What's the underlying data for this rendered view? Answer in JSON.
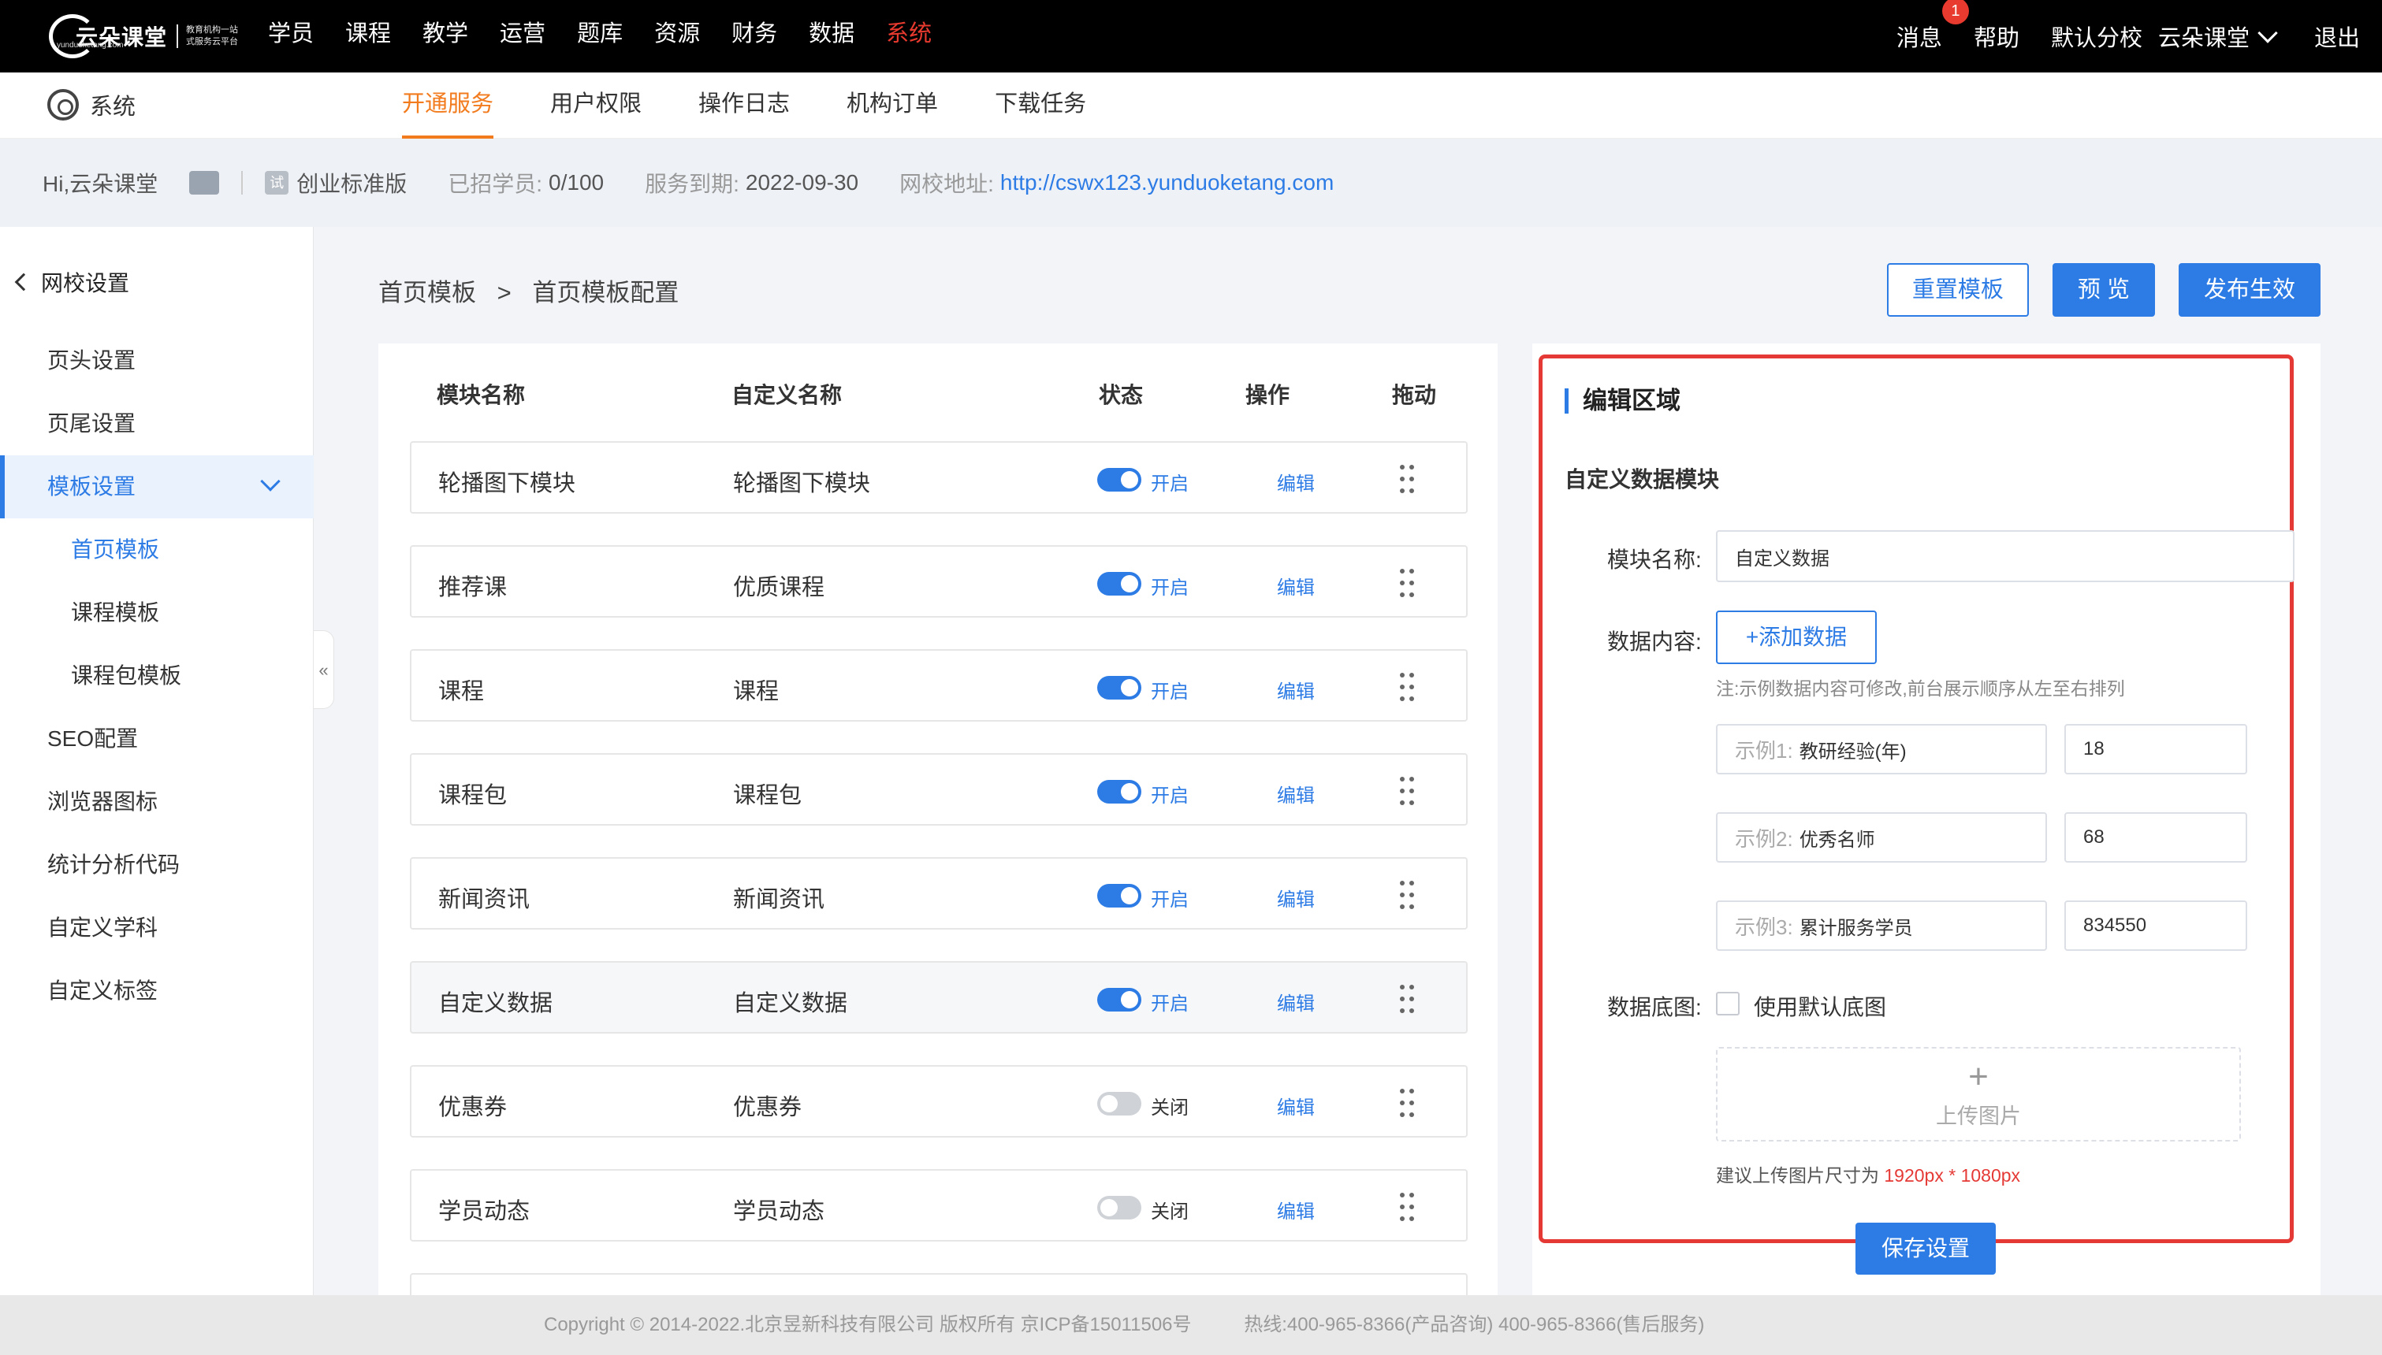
{
  "topbar": {
    "logo_text": "云朵课堂",
    "logo_sub1": "教育机构一站",
    "logo_sub2": "式服务云平台",
    "logo_url": "yunduoketang.com",
    "nav": [
      "学员",
      "课程",
      "教学",
      "运营",
      "题库",
      "资源",
      "财务",
      "数据",
      "系统"
    ],
    "active_nav": "系统",
    "messages_label": "消息",
    "messages_badge": "1",
    "help_label": "帮助",
    "branch_label": "默认分校",
    "account_label": "云朵课堂",
    "logout_label": "退出"
  },
  "subbar": {
    "section_label": "系统",
    "tabs": [
      "开通服务",
      "用户权限",
      "操作日志",
      "机构订单",
      "下载任务"
    ],
    "active_tab": "开通服务"
  },
  "infobar": {
    "greeting": "Hi,云朵课堂",
    "trial_badge": "试",
    "edition": "创业标准版",
    "students_label": "已招学员:",
    "students_value": "0/100",
    "expiry_label": "服务到期:",
    "expiry_value": "2022-09-30",
    "url_label": "网校地址:",
    "url_value": "http://cswx123.yunduoketang.com"
  },
  "sidebar": {
    "header": "网校设置",
    "items": [
      {
        "label": "页头设置",
        "level": 1
      },
      {
        "label": "页尾设置",
        "level": 1
      },
      {
        "label": "模板设置",
        "level": 1,
        "active": true
      },
      {
        "label": "首页模板",
        "level": 2,
        "active": true
      },
      {
        "label": "课程模板",
        "level": 2
      },
      {
        "label": "课程包模板",
        "level": 2
      },
      {
        "label": "SEO配置",
        "level": 1
      },
      {
        "label": "浏览器图标",
        "level": 1
      },
      {
        "label": "统计分析代码",
        "level": 1
      },
      {
        "label": "自定义学科",
        "level": 1
      },
      {
        "label": "自定义标签",
        "level": 1
      }
    ],
    "collapse_icon": "«"
  },
  "breadcrumb": {
    "parent": "首页模板",
    "separator": ">",
    "current": "首页模板配置"
  },
  "actions": {
    "reset": "重置模板",
    "preview": "预 览",
    "publish": "发布生效"
  },
  "table": {
    "headers": {
      "name": "模块名称",
      "custom": "自定义名称",
      "status": "状态",
      "op": "操作",
      "drag": "拖动"
    },
    "rows": [
      {
        "name": "轮播图下模块",
        "custom": "轮播图下模块",
        "on": true,
        "status": "开启",
        "op": "编辑"
      },
      {
        "name": "推荐课",
        "custom": "优质课程",
        "on": true,
        "status": "开启",
        "op": "编辑"
      },
      {
        "name": "课程",
        "custom": "课程",
        "on": true,
        "status": "开启",
        "op": "编辑"
      },
      {
        "name": "课程包",
        "custom": "课程包",
        "on": true,
        "status": "开启",
        "op": "编辑"
      },
      {
        "name": "新闻资讯",
        "custom": "新闻资讯",
        "on": true,
        "status": "开启",
        "op": "编辑"
      },
      {
        "name": "自定义数据",
        "custom": "自定义数据",
        "on": true,
        "status": "开启",
        "op": "编辑",
        "highlight": true
      },
      {
        "name": "优惠券",
        "custom": "优惠券",
        "on": false,
        "status": "关闭",
        "op": "编辑"
      },
      {
        "name": "学员动态",
        "custom": "学员动态",
        "on": false,
        "status": "关闭",
        "op": "编辑"
      }
    ]
  },
  "editor": {
    "title": "编辑区域",
    "subtitle": "自定义数据模块",
    "name_label": "模块名称:",
    "name_value": "自定义数据",
    "content_label": "数据内容:",
    "add_button": "+添加数据",
    "note": "注:示例数据内容可修改,前台展示顺序从左至右排列",
    "examples": [
      {
        "prefix": "示例1:",
        "label": "教研经验(年)",
        "value": "18"
      },
      {
        "prefix": "示例2:",
        "label": "优秀名师",
        "value": "68"
      },
      {
        "prefix": "示例3:",
        "label": "累计服务学员",
        "value": "834550"
      }
    ],
    "bg_label": "数据底图:",
    "bg_checkbox_label": "使用默认底图",
    "upload_plus": "+",
    "upload_label": "上传图片",
    "hint_prefix": "建议上传图片尺寸为",
    "hint_size": "1920px * 1080px",
    "save_button": "保存设置"
  },
  "footer": {
    "copyright": "Copyright © 2014-2022.北京昱新科技有限公司 版权所有 京ICP备15011506号",
    "hotline": "热线:400-965-8366(产品咨询) 400-965-8366(售后服务)"
  },
  "colors": {
    "accent": "#2d7be5",
    "active_nav": "#e83a2e",
    "tab_active": "#f27b1e",
    "highlight_border": "#e53935"
  }
}
